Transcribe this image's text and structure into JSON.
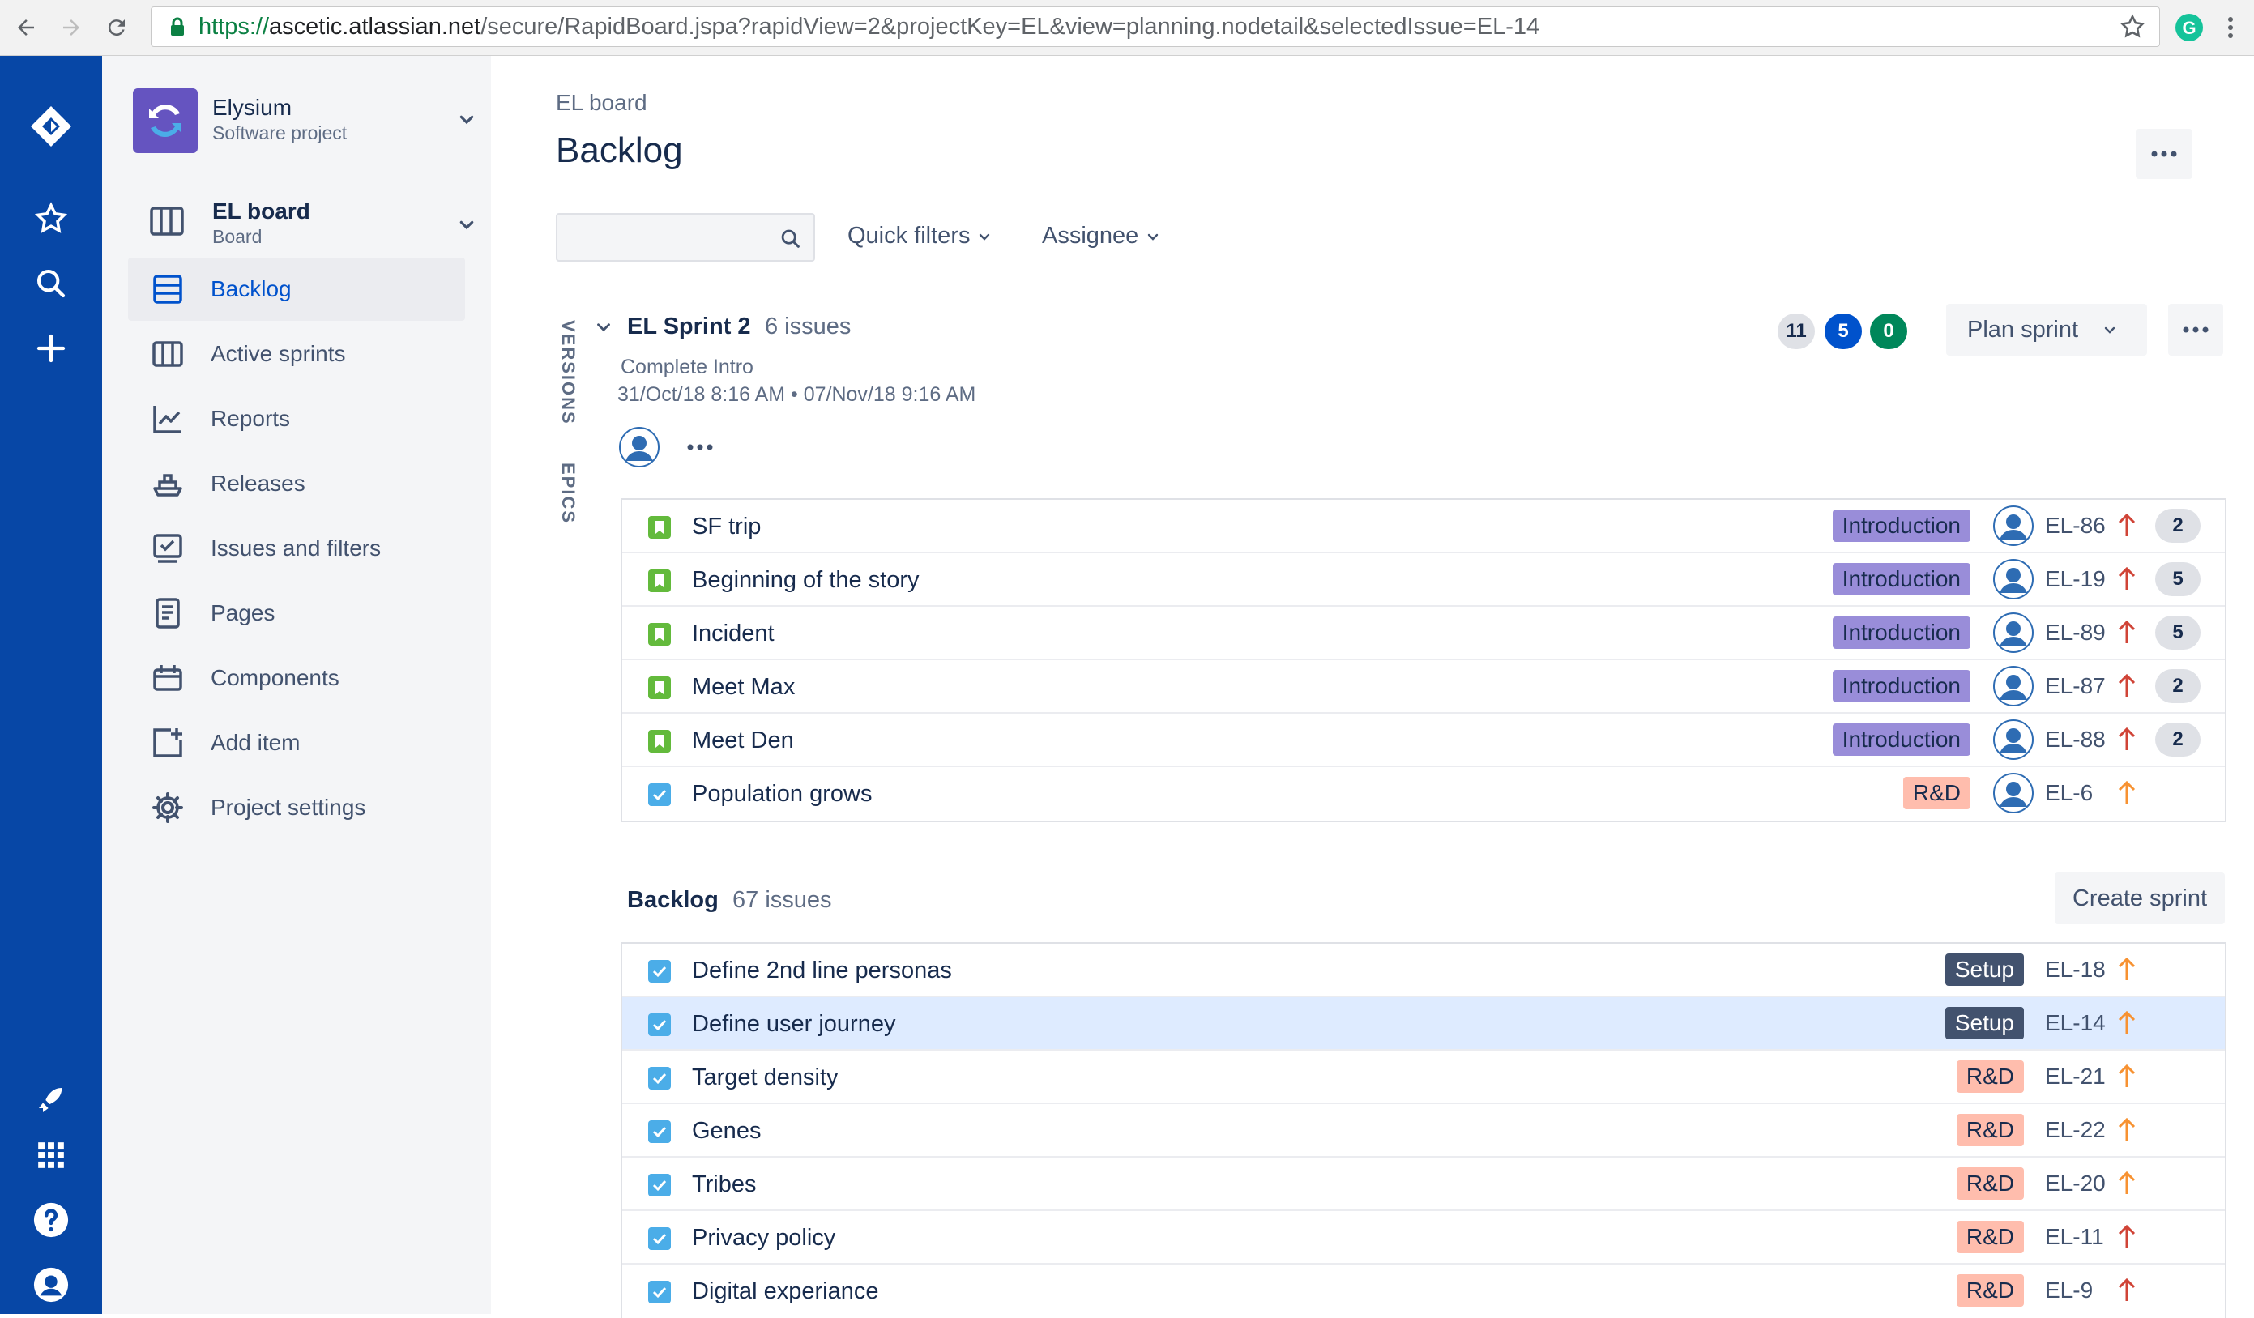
{
  "browser": {
    "url_protocol": "https://",
    "url_host": "ascetic.atlassian.net",
    "url_path": "/secure/RapidBoard.jspa?rapidView=2&projectKey=EL&view=planning.nodetail&selectedIssue=EL-14",
    "extension_letter": "G"
  },
  "project": {
    "name": "Elysium",
    "type": "Software project"
  },
  "board": {
    "name": "EL board",
    "type": "Board"
  },
  "sidebar": {
    "items": [
      {
        "label": "Backlog",
        "icon": "backlog-icon",
        "active": true
      },
      {
        "label": "Active sprints",
        "icon": "active-sprints-icon",
        "active": false
      },
      {
        "label": "Reports",
        "icon": "reports-icon",
        "active": false
      },
      {
        "label": "Releases",
        "icon": "releases-icon",
        "active": false
      },
      {
        "label": "Issues and filters",
        "icon": "issues-icon",
        "active": false
      },
      {
        "label": "Pages",
        "icon": "pages-icon",
        "active": false
      },
      {
        "label": "Components",
        "icon": "components-icon",
        "active": false
      },
      {
        "label": "Add item",
        "icon": "add-item-icon",
        "active": false
      },
      {
        "label": "Project settings",
        "icon": "settings-icon",
        "active": false
      }
    ]
  },
  "header": {
    "breadcrumb": "EL board",
    "title": "Backlog"
  },
  "filters": {
    "search_placeholder": "",
    "quick_filters": "Quick filters",
    "assignee": "Assignee"
  },
  "side_tabs": {
    "versions": "VERSIONS",
    "epics": "EPICS"
  },
  "sprint": {
    "name": "EL Sprint 2",
    "count": "6 issues",
    "goal": "Complete Intro",
    "dates": "31/Oct/18 8:16 AM • 07/Nov/18 9:16 AM",
    "points_todo": "11",
    "points_inprogress": "5",
    "points_done": "0",
    "plan_label": "Plan sprint",
    "issues": [
      {
        "summary": "SF trip",
        "type": "story",
        "epic": "Introduction",
        "epic_kind": "intro",
        "key": "EL-86",
        "priority": "high",
        "estimate": "2"
      },
      {
        "summary": "Beginning of the story",
        "type": "story",
        "epic": "Introduction",
        "epic_kind": "intro",
        "key": "EL-19",
        "priority": "high",
        "estimate": "5"
      },
      {
        "summary": "Incident",
        "type": "story",
        "epic": "Introduction",
        "epic_kind": "intro",
        "key": "EL-89",
        "priority": "high",
        "estimate": "5"
      },
      {
        "summary": "Meet Max",
        "type": "story",
        "epic": "Introduction",
        "epic_kind": "intro",
        "key": "EL-87",
        "priority": "high",
        "estimate": "2"
      },
      {
        "summary": "Meet Den",
        "type": "story",
        "epic": "Introduction",
        "epic_kind": "intro",
        "key": "EL-88",
        "priority": "high",
        "estimate": "2"
      },
      {
        "summary": "Population grows",
        "type": "task",
        "epic": "R&D",
        "epic_kind": "rd",
        "key": "EL-6",
        "priority": "medium",
        "estimate": ""
      }
    ]
  },
  "backlog": {
    "name": "Backlog",
    "count": "67 issues",
    "create_label": "Create sprint",
    "issues": [
      {
        "summary": "Define 2nd line personas",
        "epic": "Setup",
        "epic_kind": "setup",
        "key": "EL-18",
        "priority": "medium"
      },
      {
        "summary": "Define user journey",
        "epic": "Setup",
        "epic_kind": "setup",
        "key": "EL-14",
        "priority": "medium",
        "selected": true
      },
      {
        "summary": "Target density",
        "epic": "R&D",
        "epic_kind": "rd",
        "key": "EL-21",
        "priority": "medium"
      },
      {
        "summary": "Genes",
        "epic": "R&D",
        "epic_kind": "rd",
        "key": "EL-22",
        "priority": "medium"
      },
      {
        "summary": "Tribes",
        "epic": "R&D",
        "epic_kind": "rd",
        "key": "EL-20",
        "priority": "medium"
      },
      {
        "summary": "Privacy policy",
        "epic": "R&D",
        "epic_kind": "rd",
        "key": "EL-11",
        "priority": "high"
      },
      {
        "summary": "Digital experiance",
        "epic": "R&D",
        "epic_kind": "rd",
        "key": "EL-9",
        "priority": "high"
      }
    ]
  },
  "colors": {
    "global_nav": "#0747A6",
    "accent": "#0052CC",
    "priority_high": "#D04437",
    "priority_medium": "#F79232",
    "story_green": "#63BA3C",
    "task_blue": "#4BADE8"
  }
}
